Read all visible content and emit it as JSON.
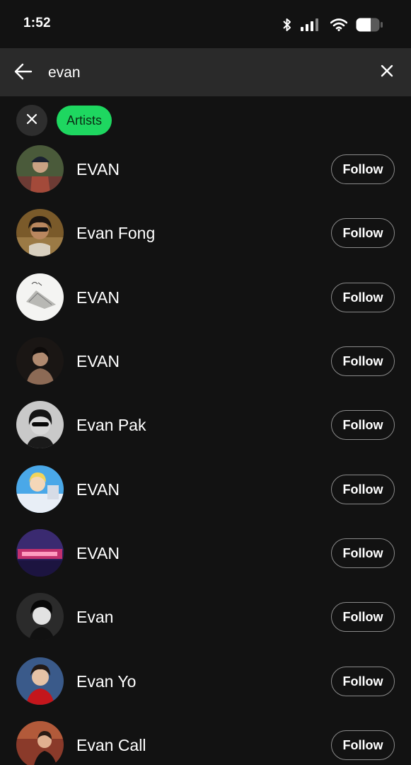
{
  "status_bar": {
    "time": "1:52",
    "icons": [
      "bluetooth-icon",
      "cellular-signal-icon",
      "wifi-icon",
      "battery-icon"
    ]
  },
  "search": {
    "query": "evan",
    "back_icon": "arrow-left-icon",
    "clear_icon": "close-icon"
  },
  "filters": {
    "clear_icon": "close-icon",
    "active_chip": "Artists"
  },
  "colors": {
    "background": "#121212",
    "search_bar": "#2a2a2a",
    "accent": "#1ed760"
  },
  "results": [
    {
      "name": "EVAN",
      "button": "Follow"
    },
    {
      "name": "Evan Fong",
      "button": "Follow"
    },
    {
      "name": "EVAN",
      "button": "Follow"
    },
    {
      "name": "EVAN",
      "button": "Follow"
    },
    {
      "name": "Evan Pak",
      "button": "Follow"
    },
    {
      "name": "EVAN",
      "button": "Follow"
    },
    {
      "name": "EVAN",
      "button": "Follow"
    },
    {
      "name": "Evan",
      "button": "Follow"
    },
    {
      "name": "Evan Yo",
      "button": "Follow"
    },
    {
      "name": "Evan Call",
      "button": "Follow"
    }
  ]
}
